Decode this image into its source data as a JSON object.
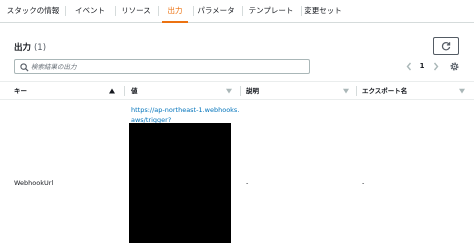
{
  "tabs": [
    {
      "label": "スタックの情報",
      "active": false
    },
    {
      "label": "イベント",
      "active": false
    },
    {
      "label": "リソース",
      "active": false
    },
    {
      "label": "出力",
      "active": true
    },
    {
      "label": "パラメータ",
      "active": false
    },
    {
      "label": "テンプレート",
      "active": false
    },
    {
      "label": "変更セット",
      "active": false
    }
  ],
  "header": {
    "title": "出力",
    "count": "(1)"
  },
  "search": {
    "placeholder": "検索結果の出力"
  },
  "pagination": {
    "current_page": "1"
  },
  "table": {
    "columns": [
      {
        "label": "キー",
        "sort": "ascending"
      },
      {
        "label": "値",
        "sort": "none"
      },
      {
        "label": "説明",
        "sort": "none"
      },
      {
        "label": "エクスポート名",
        "sort": "none"
      }
    ],
    "rows": [
      {
        "key": "WebhookUrl",
        "value": "https://ap-northeast-1.webhooks.aws/trigger?",
        "description": "-",
        "export_name": "-"
      }
    ]
  },
  "colors": {
    "accent": "#ec7211",
    "link": "#0073bb",
    "text": "#16191f",
    "border": "#d5dbdb"
  }
}
